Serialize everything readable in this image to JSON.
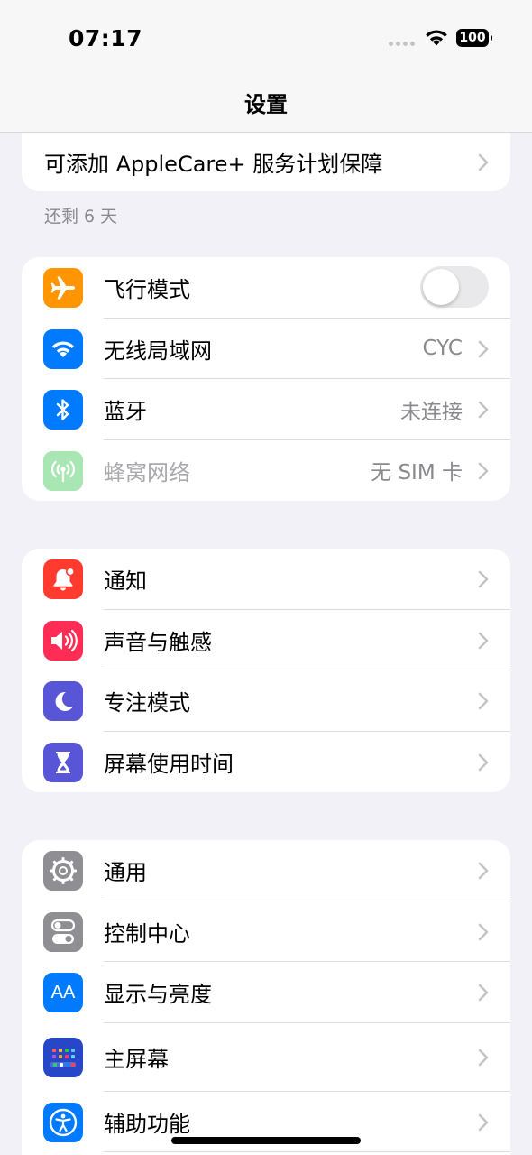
{
  "status_bar": {
    "time": "07:17",
    "battery": "100",
    "icons": [
      "cellular-dots-icon",
      "wifi-icon",
      "battery-icon"
    ]
  },
  "nav": {
    "title": "设置"
  },
  "applecare": {
    "label": "可添加 AppleCare+ 服务计划保障",
    "footnote": "还剩 6 天"
  },
  "connectivity": [
    {
      "label": "飞行模式",
      "icon": "airplane-icon",
      "color": "#ff9500",
      "toggle": false
    },
    {
      "label": "无线局域网",
      "icon": "wifi-icon",
      "color": "#007aff",
      "value": "CYC"
    },
    {
      "label": "蓝牙",
      "icon": "bluetooth-icon",
      "color": "#007aff",
      "value": "未连接"
    },
    {
      "label": "蜂窝网络",
      "icon": "cellular-icon",
      "color": "#a8e6b4",
      "value": "无 SIM 卡",
      "disabled": true
    }
  ],
  "attention": [
    {
      "label": "通知",
      "icon": "bell-icon",
      "color": "#ff3b30"
    },
    {
      "label": "声音与触感",
      "icon": "speaker-icon",
      "color": "#ff2d55"
    },
    {
      "label": "专注模式",
      "icon": "moon-icon",
      "color": "#5856d6"
    },
    {
      "label": "屏幕使用时间",
      "icon": "hourglass-icon",
      "color": "#5856d6"
    }
  ],
  "general": [
    {
      "label": "通用",
      "icon": "gear-icon",
      "color": "#8e8e93"
    },
    {
      "label": "控制中心",
      "icon": "switches-icon",
      "color": "#8e8e93"
    },
    {
      "label": "显示与亮度",
      "icon": "text-size-icon",
      "color": "#007aff",
      "glyph": "AA"
    },
    {
      "label": "主屏幕",
      "icon": "home-screen-icon",
      "color": "#2746c8"
    },
    {
      "label": "辅助功能",
      "icon": "accessibility-icon",
      "color": "#007aff"
    }
  ]
}
